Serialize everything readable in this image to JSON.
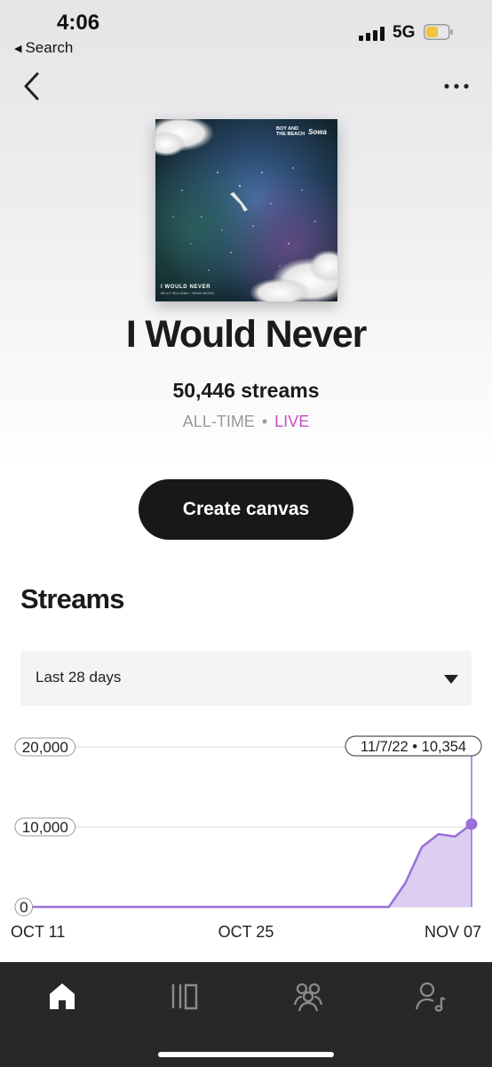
{
  "status_bar": {
    "time": "4:06",
    "back_app_label": "Search",
    "network": "5G",
    "battery_color": "#f0c43c"
  },
  "nav": {
    "back_icon": "chevron-left-icon",
    "more_icon": "more-dots-icon"
  },
  "song": {
    "title": "I Would Never",
    "streams_text": "50,446 streams",
    "period": "ALL-TIME",
    "separator": "•",
    "live_label": "LIVE",
    "live_color": "#c94fbf"
  },
  "artwork": {
    "logo_left": "BOY AND THE BEACH",
    "logo_right": "Sowa",
    "cover_title": "I WOULD NEVER",
    "cover_subtitle": "MILLY WILLMAN / SEAN WOOD"
  },
  "actions": {
    "create_canvas_label": "Create canvas"
  },
  "streams_section": {
    "title": "Streams",
    "range_selected": "Last 28 days"
  },
  "chart_data": {
    "type": "area",
    "x_tick_labels": [
      "OCT 11",
      "OCT 25",
      "NOV 07"
    ],
    "y_tick_labels": [
      "20,000",
      "10,000",
      "0"
    ],
    "ylim": [
      0,
      20000
    ],
    "x_dates": [
      "10/11/22",
      "10/12/22",
      "10/13/22",
      "10/14/22",
      "10/15/22",
      "10/16/22",
      "10/17/22",
      "10/18/22",
      "10/19/22",
      "10/20/22",
      "10/21/22",
      "10/22/22",
      "10/23/22",
      "10/24/22",
      "10/25/22",
      "10/26/22",
      "10/27/22",
      "10/28/22",
      "10/29/22",
      "10/30/22",
      "10/31/22",
      "11/1/22",
      "11/2/22",
      "11/3/22",
      "11/4/22",
      "11/5/22",
      "11/6/22",
      "11/7/22"
    ],
    "values": [
      0,
      0,
      0,
      0,
      0,
      0,
      0,
      0,
      0,
      0,
      0,
      0,
      0,
      0,
      0,
      0,
      0,
      0,
      0,
      0,
      0,
      0,
      0,
      3000,
      7500,
      9100,
      8800,
      10354
    ],
    "tooltip": "11/7/22 • 10,354",
    "color": "#9b6fd8",
    "fill_color": "#dccdf2",
    "grid": true
  },
  "tabbar": {
    "tabs": [
      {
        "icon": "home-icon",
        "active": true
      },
      {
        "icon": "music-catalog-icon",
        "active": false
      },
      {
        "icon": "audience-icon",
        "active": false
      },
      {
        "icon": "profile-icon",
        "active": false
      }
    ]
  }
}
